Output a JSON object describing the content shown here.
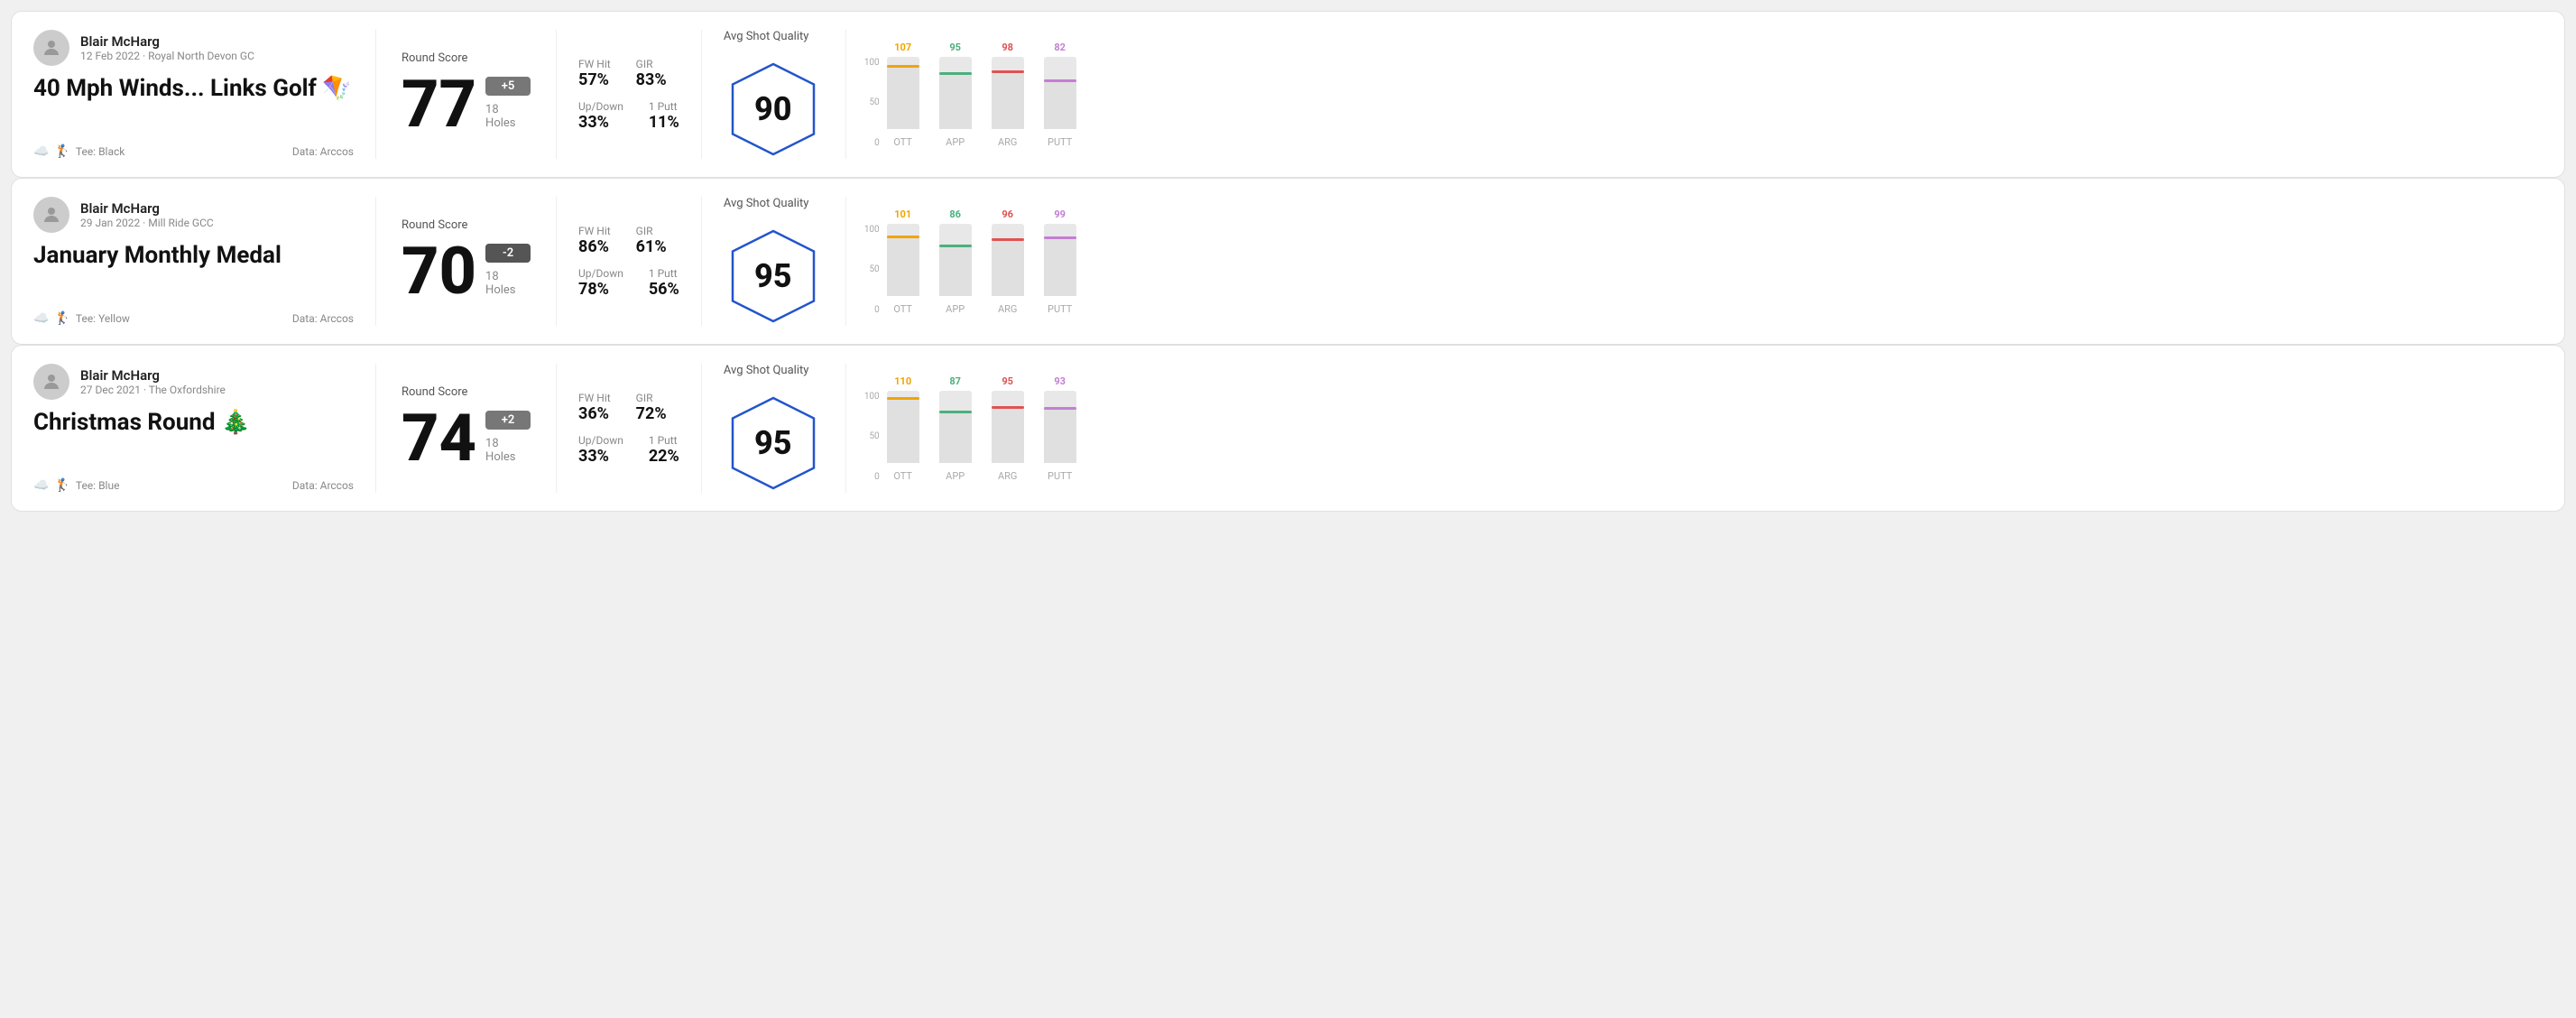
{
  "rounds": [
    {
      "id": "round1",
      "player": {
        "name": "Blair McHarg",
        "date": "12 Feb 2022",
        "course": "Royal North Devon GC"
      },
      "title": "40 Mph Winds... Links Golf 🪁",
      "tee": "Black",
      "data_source": "Arccos",
      "score": {
        "label": "Round Score",
        "value": "77",
        "modifier": "+5",
        "modifier_type": "positive",
        "holes": "18 Holes"
      },
      "stats": {
        "fw_hit_label": "FW Hit",
        "fw_hit_value": "57%",
        "gir_label": "GIR",
        "gir_value": "83%",
        "updown_label": "Up/Down",
        "updown_value": "33%",
        "oneputt_label": "1 Putt",
        "oneputt_value": "11%"
      },
      "quality": {
        "label": "Avg Shot Quality",
        "score": "90"
      },
      "chart": {
        "bars": [
          {
            "label": "OTT",
            "value": 107,
            "color": "#f0a500",
            "max": 120
          },
          {
            "label": "APP",
            "value": 95,
            "color": "#4caf7d",
            "max": 120
          },
          {
            "label": "ARG",
            "value": 98,
            "color": "#e05252",
            "max": 120
          },
          {
            "label": "PUTT",
            "value": 82,
            "color": "#c47ed4",
            "max": 120
          }
        ],
        "y_labels": [
          "100",
          "50",
          "0"
        ]
      }
    },
    {
      "id": "round2",
      "player": {
        "name": "Blair McHarg",
        "date": "29 Jan 2022",
        "course": "Mill Ride GCC"
      },
      "title": "January Monthly Medal",
      "tee": "Yellow",
      "data_source": "Arccos",
      "score": {
        "label": "Round Score",
        "value": "70",
        "modifier": "-2",
        "modifier_type": "negative",
        "holes": "18 Holes"
      },
      "stats": {
        "fw_hit_label": "FW Hit",
        "fw_hit_value": "86%",
        "gir_label": "GIR",
        "gir_value": "61%",
        "updown_label": "Up/Down",
        "updown_value": "78%",
        "oneputt_label": "1 Putt",
        "oneputt_value": "56%"
      },
      "quality": {
        "label": "Avg Shot Quality",
        "score": "95"
      },
      "chart": {
        "bars": [
          {
            "label": "OTT",
            "value": 101,
            "color": "#f0a500",
            "max": 120
          },
          {
            "label": "APP",
            "value": 86,
            "color": "#4caf7d",
            "max": 120
          },
          {
            "label": "ARG",
            "value": 96,
            "color": "#e05252",
            "max": 120
          },
          {
            "label": "PUTT",
            "value": 99,
            "color": "#c47ed4",
            "max": 120
          }
        ],
        "y_labels": [
          "100",
          "50",
          "0"
        ]
      }
    },
    {
      "id": "round3",
      "player": {
        "name": "Blair McHarg",
        "date": "27 Dec 2021",
        "course": "The Oxfordshire"
      },
      "title": "Christmas Round 🎄",
      "tee": "Blue",
      "data_source": "Arccos",
      "score": {
        "label": "Round Score",
        "value": "74",
        "modifier": "+2",
        "modifier_type": "positive",
        "holes": "18 Holes"
      },
      "stats": {
        "fw_hit_label": "FW Hit",
        "fw_hit_value": "36%",
        "gir_label": "GIR",
        "gir_value": "72%",
        "updown_label": "Up/Down",
        "updown_value": "33%",
        "oneputt_label": "1 Putt",
        "oneputt_value": "22%"
      },
      "quality": {
        "label": "Avg Shot Quality",
        "score": "95"
      },
      "chart": {
        "bars": [
          {
            "label": "OTT",
            "value": 110,
            "color": "#f0a500",
            "max": 120
          },
          {
            "label": "APP",
            "value": 87,
            "color": "#4caf7d",
            "max": 120
          },
          {
            "label": "ARG",
            "value": 95,
            "color": "#e05252",
            "max": 120
          },
          {
            "label": "PUTT",
            "value": 93,
            "color": "#c47ed4",
            "max": 120
          }
        ],
        "y_labels": [
          "100",
          "50",
          "0"
        ]
      }
    }
  ]
}
